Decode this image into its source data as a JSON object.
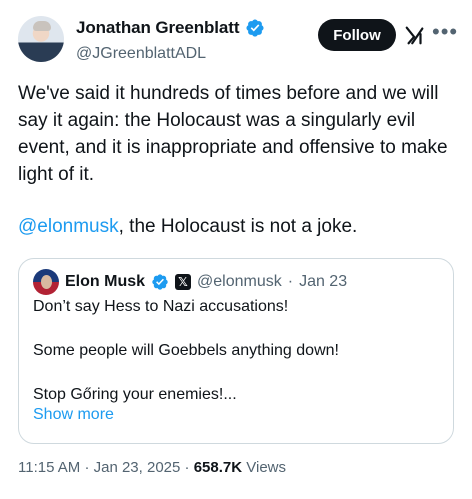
{
  "author": {
    "display_name": "Jonathan Greenblatt",
    "handle": "@JGreenblattADL",
    "verified": true
  },
  "actions": {
    "follow_label": "Follow",
    "grok_icon": "grok-icon",
    "more_icon": "more-icon"
  },
  "tweet": {
    "paragraph1": "We've said it hundreds of times before and we will say it again: the Holocaust was a singularly evil event, and it is inappropriate and offensive to make light of it.",
    "mention": "@elonmusk",
    "paragraph2_rest": ", the Holocaust is not a joke."
  },
  "quoted": {
    "display_name": "Elon Musk",
    "handle": "@elonmusk",
    "separator": "·",
    "date": "Jan 23",
    "lines": [
      "Don’t say Hess to Nazi accusations!",
      "Some people will Goebbels anything down!",
      "Stop Gőring your enemies!..."
    ],
    "show_more": "Show more"
  },
  "meta": {
    "time": "11:15 AM",
    "sep1": "·",
    "date": "Jan 23, 2025",
    "sep2": "·",
    "views_count": "658.7K",
    "views_label": "Views"
  },
  "colors": {
    "accent": "#1d9bf0",
    "text": "#0f1419",
    "secondary": "#536471",
    "border": "#cfd9de"
  }
}
